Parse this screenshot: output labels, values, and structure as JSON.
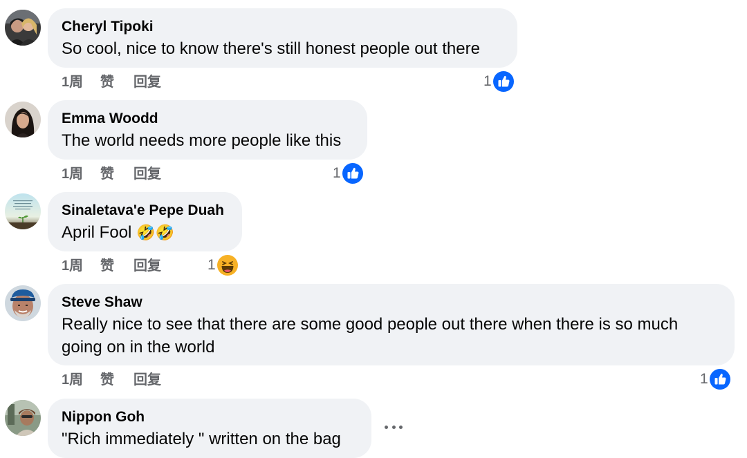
{
  "comments": [
    {
      "author": "Cheryl Tipoki",
      "text": "So cool, nice to know there's still honest people out there",
      "time": "1周",
      "like_label": "赞",
      "reply_label": "回复",
      "reaction_count": "1",
      "reaction_icon": "like-icon"
    },
    {
      "author": "Emma Woodd",
      "text": "The world needs more people like this",
      "time": "1周",
      "like_label": "赞",
      "reply_label": "回复",
      "reaction_count": "1",
      "reaction_icon": "like-icon"
    },
    {
      "author": "Sinaletava'e Pepe Duah",
      "text": "April Fool",
      "text_emoji": "🤣🤣",
      "time": "1周",
      "like_label": "赞",
      "reply_label": "回复",
      "reaction_count": "1",
      "reaction_icon": "haha-icon"
    },
    {
      "author": "Steve Shaw",
      "text": "Really nice to see that there are some good people out there when there is so much going on in the world",
      "time": "1周",
      "like_label": "赞",
      "reply_label": "回复",
      "reaction_count": "1",
      "reaction_icon": "like-icon"
    },
    {
      "author": "Nippon Goh",
      "text": "\"Rich immediately \" written on the bag",
      "more_icon": "more-options-icon"
    }
  ],
  "colors": {
    "bubble": "#f0f2f5",
    "secondary_text": "#65676b",
    "like_blue": "#0866ff",
    "haha_yellow": "#f7b125"
  }
}
